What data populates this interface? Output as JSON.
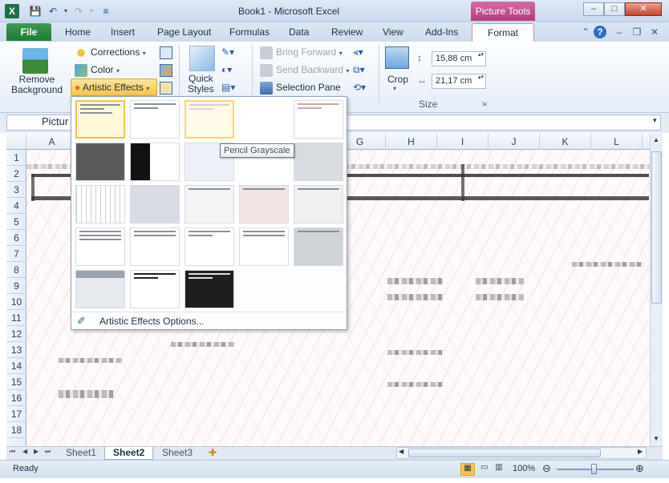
{
  "window": {
    "title": "Book1  -  Microsoft Excel",
    "app_icon": "X",
    "context_tab": "Picture Tools",
    "controls": [
      "–",
      "□",
      "✕"
    ]
  },
  "tabs": {
    "file": "File",
    "items": [
      "Home",
      "Insert",
      "Page Layout",
      "Formulas",
      "Data",
      "Review",
      "View",
      "Add-Ins"
    ],
    "format": "Format"
  },
  "ribbon": {
    "remove_background": "Remove\nBackground",
    "corrections": "Corrections",
    "color": "Color",
    "artistic_effects": "Artistic Effects",
    "quick_styles": "Quick\nStyles",
    "bring_forward": "Bring Forward",
    "send_backward": "Send Backward",
    "selection_pane": "Selection Pane",
    "crop": "Crop",
    "height": "15,88 cm",
    "width": "21,17 cm",
    "size_group": "Size"
  },
  "formula_bar": {
    "name_box": "Pictur"
  },
  "grid": {
    "columns": [
      "A",
      "G",
      "H",
      "I",
      "J",
      "K",
      "L"
    ],
    "rows": [
      "1",
      "2",
      "3",
      "4",
      "5",
      "6",
      "7",
      "8",
      "9",
      "10",
      "11",
      "12",
      "13",
      "14",
      "15",
      "16",
      "17",
      "18"
    ]
  },
  "gallery": {
    "tooltip": "Pencil Grayscale",
    "options_label": "Artistic Effects Options..."
  },
  "sheets": [
    "Sheet1",
    "Sheet2",
    "Sheet3"
  ],
  "status": {
    "ready": "Ready",
    "zoom": "100%"
  }
}
